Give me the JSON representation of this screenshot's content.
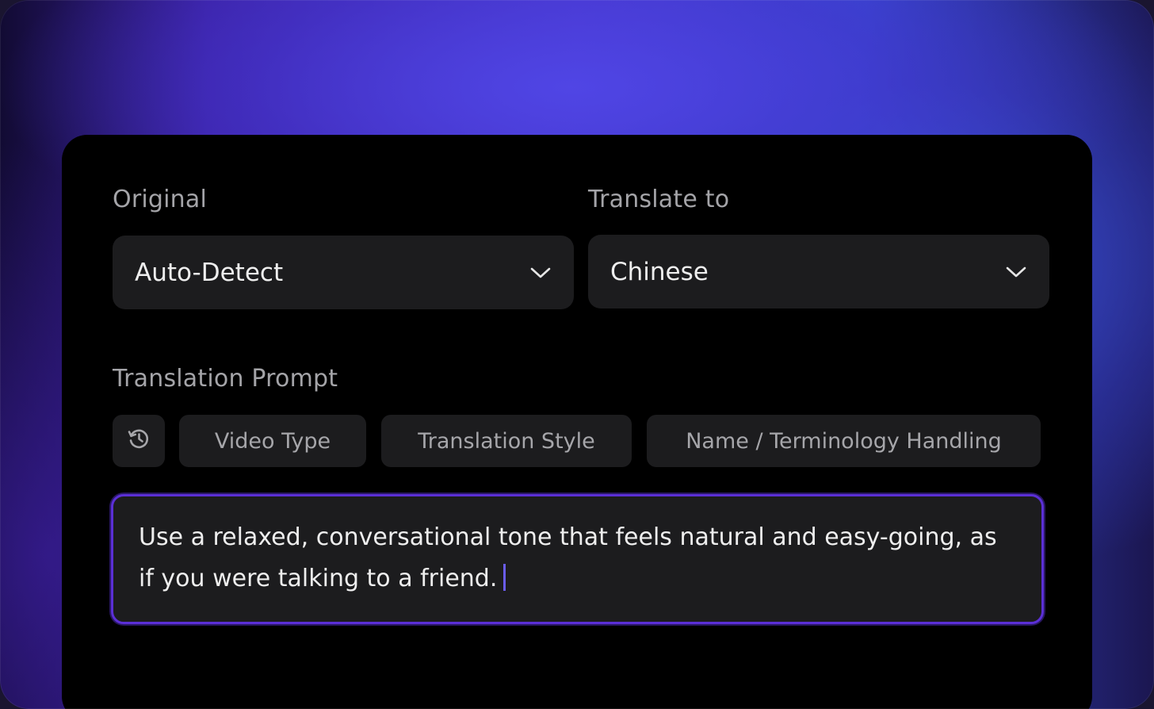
{
  "labels": {
    "original": "Original",
    "translate_to": "Translate to",
    "translation_prompt": "Translation Prompt"
  },
  "selects": {
    "original_value": "Auto-Detect",
    "target_value": "Chinese"
  },
  "chips": {
    "history_icon": "history-icon",
    "video_type": "Video Type",
    "translation_style": "Translation Style",
    "name_terminology": "Name / Terminology Handling"
  },
  "prompt": {
    "text": "Use a relaxed, conversational tone that feels natural and easy-going, as if you were talking to a friend."
  },
  "colors": {
    "accent": "#5b2fd6",
    "caret": "#6a5cf0",
    "panel": "#000000",
    "control": "#1c1c1e"
  }
}
